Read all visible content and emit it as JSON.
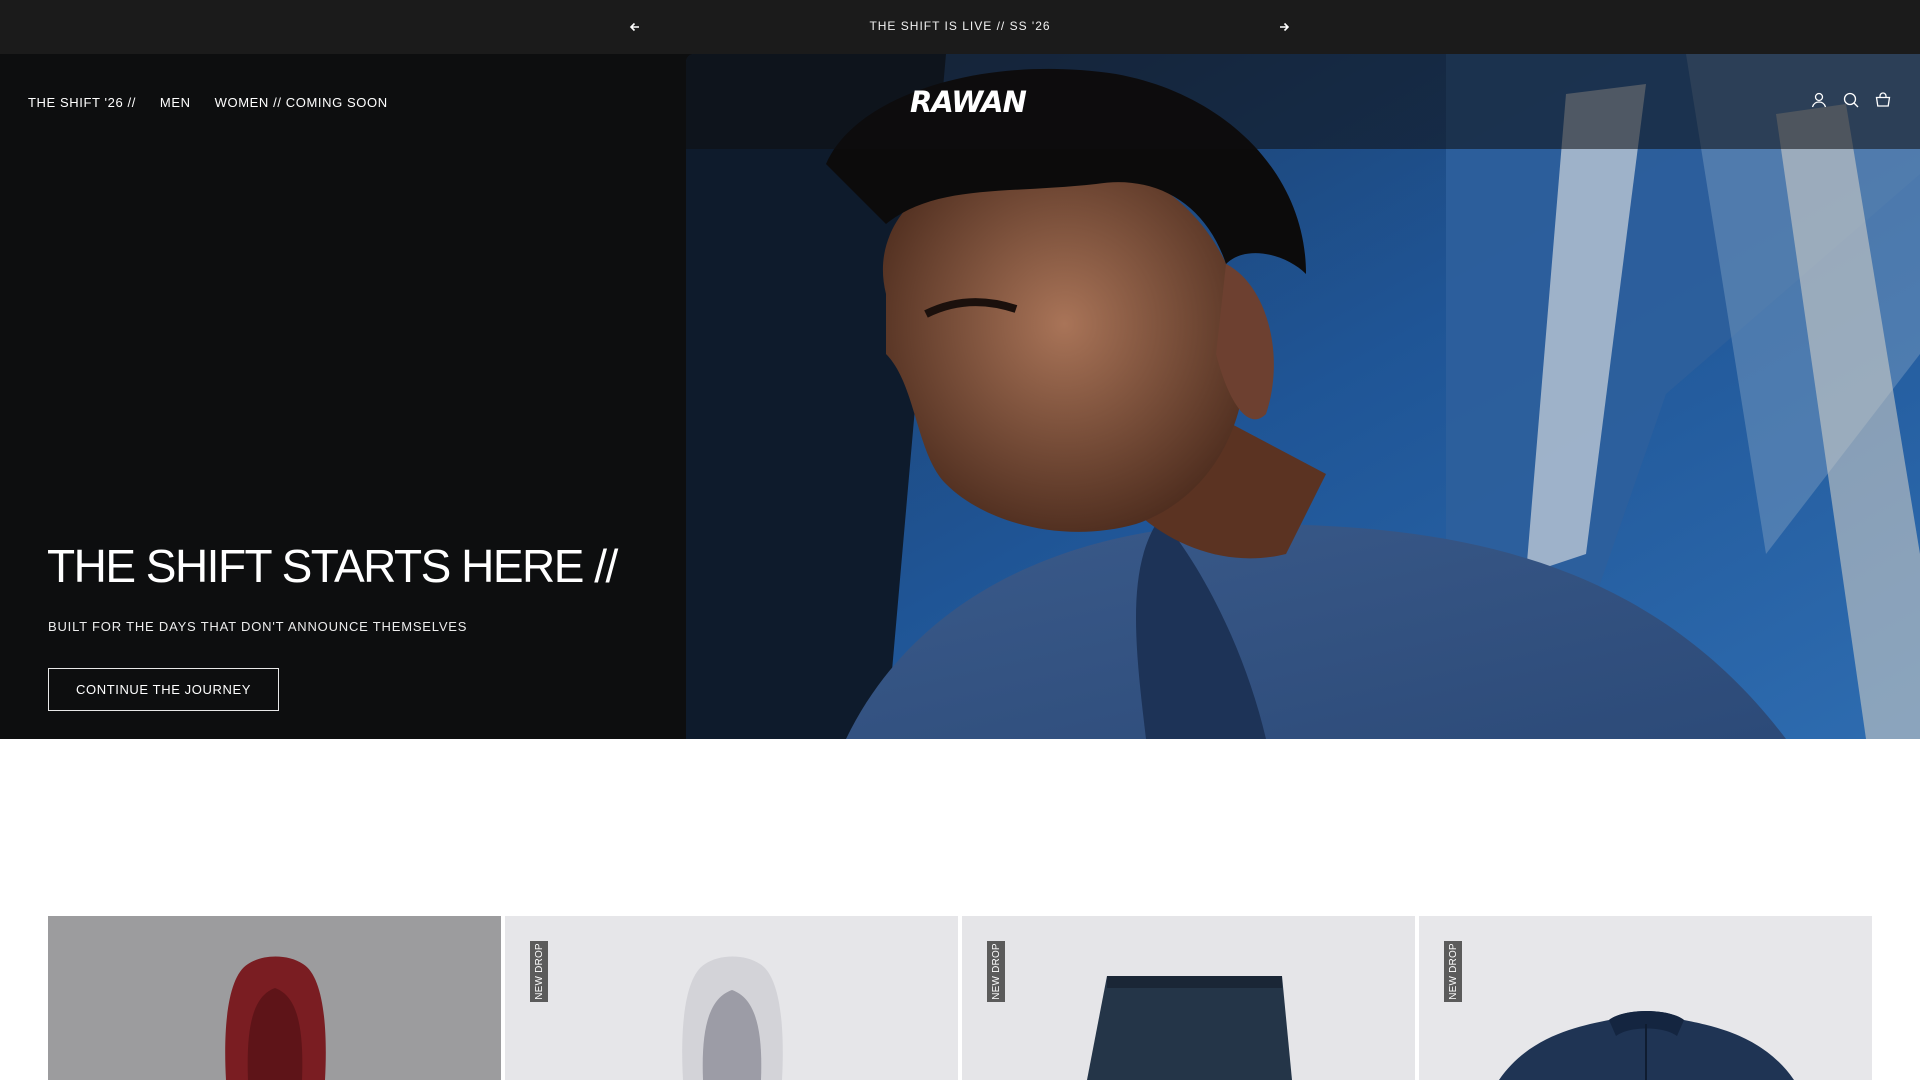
{
  "announcement": {
    "message": "THE SHIFT IS LIVE // SS '26",
    "prev_icon": "arrow-left-icon",
    "next_icon": "arrow-right-icon"
  },
  "header": {
    "nav": [
      {
        "label": "THE SHIFT '26 //"
      },
      {
        "label": "MEN"
      },
      {
        "label": "WOMEN // COMING SOON"
      }
    ],
    "logo": "RAWAN",
    "icons": [
      "account-icon",
      "search-icon",
      "cart-icon"
    ]
  },
  "hero": {
    "title": "THE SHIFT STARTS HERE //",
    "subtitle": "BUILT FOR THE DAYS THAT DON'T ANNOUNCE THEMSELVES",
    "cta": "CONTINUE THE JOURNEY"
  },
  "products": [
    {
      "badge": "",
      "image": "maroon-hoodie"
    },
    {
      "badge": "NEW DROP",
      "image": "grey-hoodie"
    },
    {
      "badge": "NEW DROP",
      "image": "navy-shorts"
    },
    {
      "badge": "NEW DROP",
      "image": "navy-quarter-zip"
    }
  ],
  "colors": {
    "announce_bg": "#1b1b1b",
    "hero_bg": "#0d0e0f",
    "text": "#ffffff",
    "badge_bg": "#5b5b5b"
  }
}
